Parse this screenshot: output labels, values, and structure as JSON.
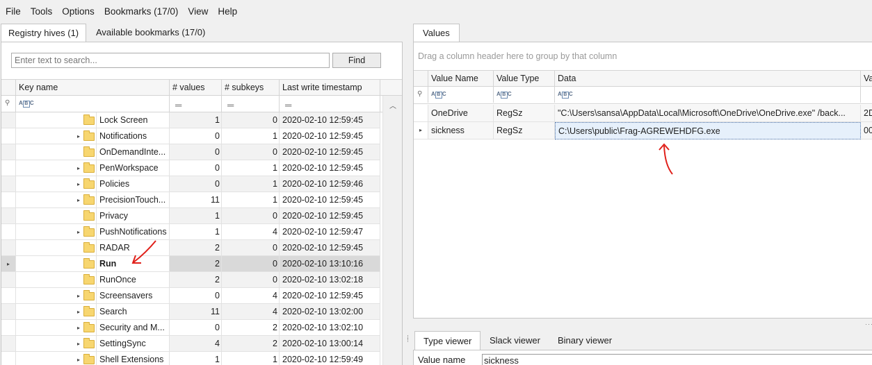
{
  "menu": [
    "File",
    "Tools",
    "Options",
    "Bookmarks (17/0)",
    "View",
    "Help"
  ],
  "left_tabs": {
    "registry": "Registry hives (1)",
    "bookmarks": "Available bookmarks (17/0)"
  },
  "search": {
    "placeholder": "Enter text to search...",
    "find_label": "Find"
  },
  "keys_grid": {
    "columns": [
      "Key name",
      "# values",
      "# subkeys",
      "Last write timestamp"
    ],
    "filter_symbols": [
      "ABC",
      "=",
      "=",
      "="
    ],
    "rows": [
      {
        "name": "Lock Screen",
        "values": "1",
        "subkeys": "0",
        "ts": "2020-02-10 12:59:45",
        "expandable": false,
        "selected": false
      },
      {
        "name": "Notifications",
        "values": "0",
        "subkeys": "1",
        "ts": "2020-02-10 12:59:45",
        "expandable": true,
        "selected": false
      },
      {
        "name": "OnDemandInte...",
        "values": "0",
        "subkeys": "0",
        "ts": "2020-02-10 12:59:45",
        "expandable": false,
        "selected": false
      },
      {
        "name": "PenWorkspace",
        "values": "0",
        "subkeys": "1",
        "ts": "2020-02-10 12:59:45",
        "expandable": true,
        "selected": false
      },
      {
        "name": "Policies",
        "values": "0",
        "subkeys": "1",
        "ts": "2020-02-10 12:59:46",
        "expandable": true,
        "selected": false
      },
      {
        "name": "PrecisionTouch...",
        "values": "11",
        "subkeys": "1",
        "ts": "2020-02-10 12:59:45",
        "expandable": true,
        "selected": false
      },
      {
        "name": "Privacy",
        "values": "1",
        "subkeys": "0",
        "ts": "2020-02-10 12:59:45",
        "expandable": false,
        "selected": false
      },
      {
        "name": "PushNotifications",
        "values": "1",
        "subkeys": "4",
        "ts": "2020-02-10 12:59:47",
        "expandable": true,
        "selected": false
      },
      {
        "name": "RADAR",
        "values": "2",
        "subkeys": "0",
        "ts": "2020-02-10 12:59:45",
        "expandable": false,
        "selected": false
      },
      {
        "name": "Run",
        "values": "2",
        "subkeys": "0",
        "ts": "2020-02-10 13:10:16",
        "expandable": false,
        "selected": true
      },
      {
        "name": "RunOnce",
        "values": "2",
        "subkeys": "0",
        "ts": "2020-02-10 13:02:18",
        "expandable": false,
        "selected": false
      },
      {
        "name": "Screensavers",
        "values": "0",
        "subkeys": "4",
        "ts": "2020-02-10 12:59:45",
        "expandable": true,
        "selected": false
      },
      {
        "name": "Search",
        "values": "11",
        "subkeys": "4",
        "ts": "2020-02-10 13:02:00",
        "expandable": true,
        "selected": false
      },
      {
        "name": "Security and M...",
        "values": "0",
        "subkeys": "2",
        "ts": "2020-02-10 13:02:10",
        "expandable": true,
        "selected": false
      },
      {
        "name": "SettingSync",
        "values": "4",
        "subkeys": "2",
        "ts": "2020-02-10 13:00:14",
        "expandable": true,
        "selected": false
      },
      {
        "name": "Shell Extensions",
        "values": "1",
        "subkeys": "1",
        "ts": "2020-02-10 12:59:49",
        "expandable": true,
        "selected": false
      }
    ]
  },
  "values_tab": "Values",
  "values_grid": {
    "group_hint": "Drag a column header here to group by that column",
    "columns": [
      "Value Name",
      "Value Type",
      "Data",
      "Va"
    ],
    "rows": [
      {
        "name": "OneDrive",
        "type": "RegSz",
        "data": "\"C:\\Users\\sansa\\AppData\\Local\\Microsoft\\OneDrive\\OneDrive.exe\" /back...",
        "extra": "2D",
        "current": false
      },
      {
        "name": "sickness",
        "type": "RegSz",
        "data": "C:\\Users\\public\\Frag-AGREWEHDFG.exe",
        "extra": "00",
        "current": true
      }
    ]
  },
  "bottom_tabs": [
    "Type viewer",
    "Slack viewer",
    "Binary viewer"
  ],
  "type_viewer": {
    "label": "Value name",
    "value": "sickness"
  },
  "colors": {
    "annotation": "#e0201a",
    "selected_row": "#d9d9d9",
    "alt_row": "#f2f2f2"
  }
}
